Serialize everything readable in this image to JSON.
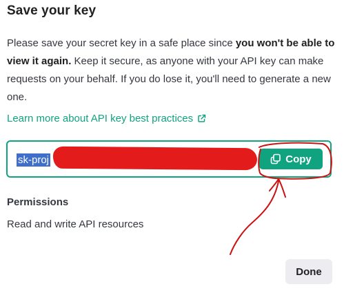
{
  "dialog": {
    "title": "Save your key",
    "description": {
      "part1": "Please save your secret key in a safe place since ",
      "emphasis": "you won't be able to view it again.",
      "part2": " Keep it secure, as anyone with your API key can make requests on your behalf. If you do lose it, you'll need to generate a new one."
    },
    "learn_more_link": "Learn more about API key best practices",
    "link_icon": "external-link-icon",
    "key_field": {
      "visible_value": "sk-proj",
      "redacted": true
    },
    "copy_button": {
      "label": "Copy",
      "icon": "copy-icon"
    },
    "permissions": {
      "label": "Permissions",
      "value": "Read and write API resources"
    },
    "done_button": {
      "label": "Done"
    }
  },
  "colors": {
    "accent": "#10a37f",
    "text": "#202123",
    "selection": "#3f6fc8",
    "redaction": "#e31b1b",
    "annotation": "#cc1111",
    "done_bg": "#ececf1"
  }
}
